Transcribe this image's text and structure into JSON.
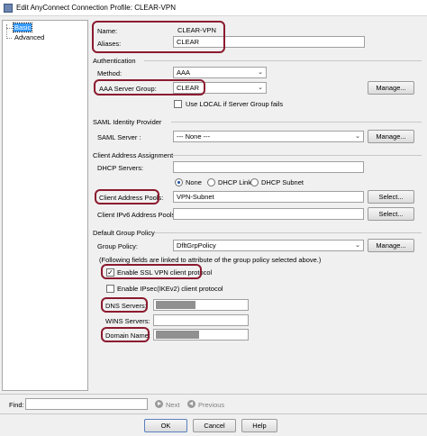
{
  "window": {
    "title": "Edit AnyConnect Connection Profile: CLEAR-VPN"
  },
  "tree": {
    "items": [
      {
        "label": "Basic"
      },
      {
        "label": "Advanced"
      }
    ]
  },
  "basic": {
    "name_label": "Name:",
    "name_value": "CLEAR-VPN",
    "aliases_label": "Aliases:",
    "aliases_value": "CLEAR"
  },
  "authentication": {
    "section": "Authentication",
    "method_label": "Method:",
    "method_value": "AAA",
    "server_group_label": "AAA Server Group:",
    "server_group_value": "CLEAR",
    "manage_label": "Manage...",
    "use_local_label": "Use LOCAL if Server Group fails"
  },
  "saml": {
    "section": "SAML Identity Provider",
    "server_label": "SAML Server :",
    "server_value": "--- None ---",
    "manage_label": "Manage..."
  },
  "client_address": {
    "section": "Client Address Assignment",
    "dhcp_label": "DHCP Servers:",
    "radio_none": "None",
    "radio_dhcp_link": "DHCP Link",
    "radio_dhcp_subnet": "DHCP Subnet",
    "pools_label": "Client Address Pools:",
    "pools_value": "VPN-Subnet",
    "select_label": "Select...",
    "ipv6_label": "Client IPv6 Address Pools:",
    "select_label_2": "Select..."
  },
  "group_policy": {
    "section": "Default Group Policy",
    "policy_label": "Group Policy:",
    "policy_value": "DfltGrpPolicy",
    "manage_label": "Manage...",
    "note": "(Following fields are linked to attribute of the group policy selected above.)",
    "ssl_label": "Enable SSL VPN client protocol",
    "ssl_checked": true,
    "ipsec_label": "Enable IPsec(IKEv2) client protocol",
    "ipsec_checked": false,
    "dns_label": "DNS Servers:",
    "wins_label": "WINS Servers:",
    "domain_label": "Domain Name:"
  },
  "find": {
    "label": "Find:",
    "next": "Next",
    "previous": "Previous"
  },
  "buttons": {
    "ok": "OK",
    "cancel": "Cancel",
    "help": "Help"
  },
  "colors": {
    "highlight": "#8b1a2e",
    "selection": "#3399ff"
  }
}
